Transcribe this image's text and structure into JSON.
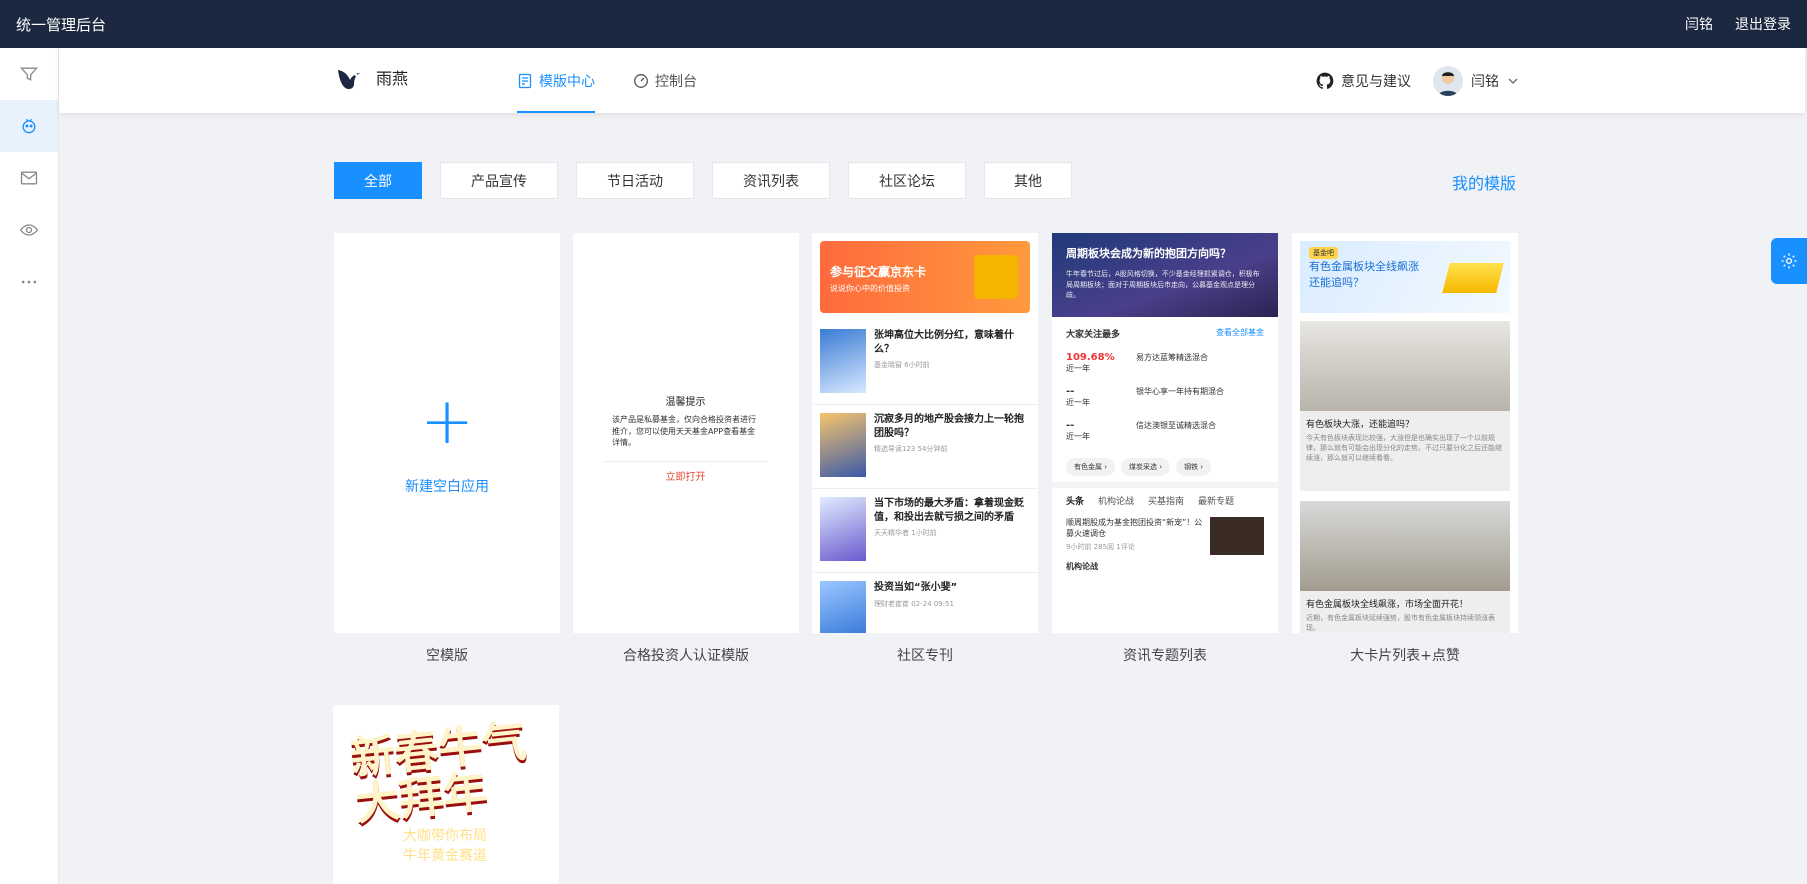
{
  "topbar": {
    "title": "统一管理后台",
    "user": "闫铭",
    "logout": "退出登录"
  },
  "leftnav": {
    "items": [
      "filter-icon",
      "bot-icon",
      "mail-icon",
      "eye-icon",
      "more-icon"
    ]
  },
  "header": {
    "brand": "雨燕",
    "tabs": [
      {
        "label": "模版中心",
        "icon": "template-icon"
      },
      {
        "label": "控制台",
        "icon": "dashboard-icon"
      }
    ],
    "feedback": "意见与建议",
    "user": "闫铭"
  },
  "filters": [
    "全部",
    "产品宣传",
    "节日活动",
    "资讯列表",
    "社区论坛",
    "其他"
  ],
  "my_templates": "我的模版",
  "cards": [
    {
      "caption": "空模版",
      "blank_label": "新建空白应用"
    },
    {
      "caption": "合格投资人认证模版",
      "modal_title": "温馨提示",
      "modal_body": "该产品是私募基金，仅向合格投资者进行推介，您可以使用天天基金APP查看基金详情。",
      "modal_button": "立即打开"
    },
    {
      "caption": "社区专刊",
      "banner_title": "参与征文赢京东卡",
      "banner_sub": "说说你心中的价值投资",
      "articles": [
        {
          "title": "张坤高位大比例分红，意味着什么？",
          "meta": "基金晓窗 6小时前"
        },
        {
          "title": "沉寂多月的地产股会接力上一轮抱团股吗？",
          "meta": "精选导读123 54分钟前"
        },
        {
          "title": "当下市场的最大矛盾：拿着现金贬值，和投出去就亏损之间的矛盾",
          "meta": "天天精华者 1小时前"
        },
        {
          "title": "投资当如“张小斐”",
          "meta": "理财老崔崔 02-24 09:51"
        }
      ]
    },
    {
      "caption": "资讯专题列表",
      "top_title": "周期板块会成为新的抱团方向吗？",
      "top_sub": "牛年春节过后，A股风格切换，不少基金经理抓紧调仓，积极布局周期板块；面对于周期板块后市走向，公募基金观点是理分歧。",
      "section": "大家关注最多",
      "section_link": "查看全部基金",
      "funds": [
        {
          "value": "109.68%",
          "period": "近一年",
          "name": "易方达蓝筹精选混合"
        },
        {
          "value": "--",
          "period": "近一年",
          "name": "银华心享一年持有期混合"
        },
        {
          "value": "--",
          "period": "近一年",
          "name": "信达澳银至诚精选混合"
        }
      ],
      "chips": [
        "有色金属 ›",
        "煤炭采选 ›",
        "钢铁 ›"
      ],
      "news_tabs": [
        "头条",
        "机构论战",
        "买基指南",
        "最新专题"
      ],
      "news_item": "顺周期股成为基金抱团投资“新宠”！公募火速调仓",
      "news_meta": "9小时前 285阅 1评论",
      "bottom": "机构论战"
    },
    {
      "caption": "大卡片列表+点赞",
      "top": "有色金属板块全线飙涨还能追吗？",
      "tag": "基金吧",
      "item1_title": "有色板块大涨，还能追吗？",
      "item1_desc": "今天有色板块表现比较强，大涨但是也确实出现了一个以前规律，那么就有可能会出现分化的走势。不过只要分化之后还能继续涨，那么就可以继续看看。",
      "item2_title": "有色金属板块全线飙涨，市场全面开花！",
      "item2_desc": "近期，有色金属板块延续强势，股市有色金属板块持续领涨表现。"
    },
    {
      "caption": "",
      "big": "新春牛气大拜年",
      "sub1": "大咖带你布局",
      "sub2": "牛年黄金赛道"
    }
  ]
}
